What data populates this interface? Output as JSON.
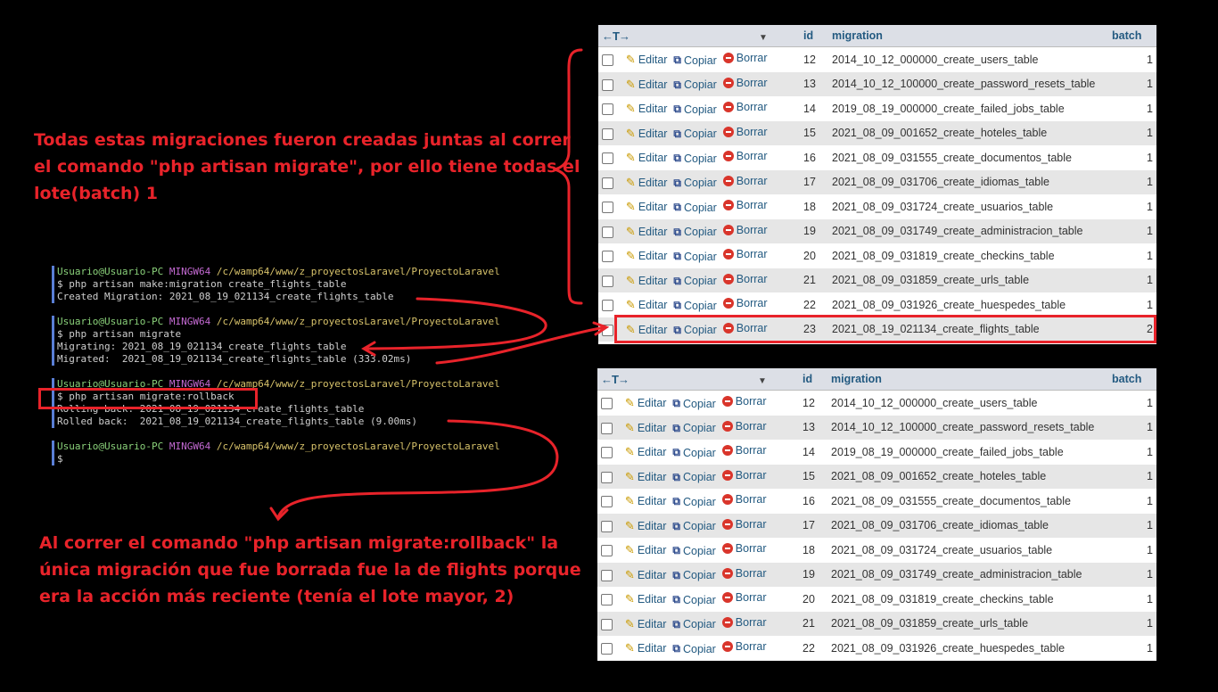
{
  "annotations": {
    "top_note": [
      "Todas estas migraciones fueron creadas juntas al correr",
      "el comando \"php artisan migrate\", por ello tiene todas el",
      "lote(batch) 1"
    ],
    "bottom_note": [
      "Al correr el comando \"php artisan migrate:rollback\" la",
      "única migración que fue borrada fue la de flights porque",
      "era la acción más reciente (tenía el lote mayor, 2)"
    ]
  },
  "terminal": {
    "prompt_user": "Usuario@Usuario-PC",
    "prompt_shell": "MINGW64",
    "prompt_path": "/c/wamp64/www/z_proyectosLaravel/ProyectoLaravel",
    "lines": [
      {
        "cmd": "$ php artisan make:migration create_flights_table"
      },
      {
        "out": "Created Migration: 2021_08_19_021134_create_flights_table"
      },
      {
        "cmd": "$ php artisan migrate"
      },
      {
        "out": "Migrating: 2021_08_19_021134_create_flights_table"
      },
      {
        "out": "Migrated:  2021_08_19_021134_create_flights_table (333.02ms)"
      },
      {
        "cmd": "$ php artisan migrate:rollback"
      },
      {
        "out": "Rolling back: 2021_08_19_021134_create_flights_table"
      },
      {
        "out": "Rolled back:  2021_08_19_021134_create_flights_table (9.00ms)"
      },
      {
        "cmd": "$"
      }
    ]
  },
  "table_header": {
    "arrows": "←T→",
    "col_id": "id",
    "col_migration": "migration",
    "col_batch": "batch"
  },
  "actions": {
    "edit": "Editar",
    "copy": "Copiar",
    "delete": "Borrar"
  },
  "top_table": [
    {
      "id": "12",
      "migration": "2014_10_12_000000_create_users_table",
      "batch": "1"
    },
    {
      "id": "13",
      "migration": "2014_10_12_100000_create_password_resets_table",
      "batch": "1"
    },
    {
      "id": "14",
      "migration": "2019_08_19_000000_create_failed_jobs_table",
      "batch": "1"
    },
    {
      "id": "15",
      "migration": "2021_08_09_001652_create_hoteles_table",
      "batch": "1"
    },
    {
      "id": "16",
      "migration": "2021_08_09_031555_create_documentos_table",
      "batch": "1"
    },
    {
      "id": "17",
      "migration": "2021_08_09_031706_create_idiomas_table",
      "batch": "1"
    },
    {
      "id": "18",
      "migration": "2021_08_09_031724_create_usuarios_table",
      "batch": "1"
    },
    {
      "id": "19",
      "migration": "2021_08_09_031749_create_administracion_table",
      "batch": "1"
    },
    {
      "id": "20",
      "migration": "2021_08_09_031819_create_checkins_table",
      "batch": "1"
    },
    {
      "id": "21",
      "migration": "2021_08_09_031859_create_urls_table",
      "batch": "1"
    },
    {
      "id": "22",
      "migration": "2021_08_09_031926_create_huespedes_table",
      "batch": "1"
    },
    {
      "id": "23",
      "migration": "2021_08_19_021134_create_flights_table",
      "batch": "2"
    }
  ],
  "bottom_table": [
    {
      "id": "12",
      "migration": "2014_10_12_000000_create_users_table",
      "batch": "1"
    },
    {
      "id": "13",
      "migration": "2014_10_12_100000_create_password_resets_table",
      "batch": "1"
    },
    {
      "id": "14",
      "migration": "2019_08_19_000000_create_failed_jobs_table",
      "batch": "1"
    },
    {
      "id": "15",
      "migration": "2021_08_09_001652_create_hoteles_table",
      "batch": "1"
    },
    {
      "id": "16",
      "migration": "2021_08_09_031555_create_documentos_table",
      "batch": "1"
    },
    {
      "id": "17",
      "migration": "2021_08_09_031706_create_idiomas_table",
      "batch": "1"
    },
    {
      "id": "18",
      "migration": "2021_08_09_031724_create_usuarios_table",
      "batch": "1"
    },
    {
      "id": "19",
      "migration": "2021_08_09_031749_create_administracion_table",
      "batch": "1"
    },
    {
      "id": "20",
      "migration": "2021_08_09_031819_create_checkins_table",
      "batch": "1"
    },
    {
      "id": "21",
      "migration": "2021_08_09_031859_create_urls_table",
      "batch": "1"
    },
    {
      "id": "22",
      "migration": "2021_08_09_031926_create_huespedes_table",
      "batch": "1"
    }
  ],
  "colors": {
    "annotation_red": "#e8232a",
    "header_bg": "#dcdfe6",
    "link_blue": "#235a81"
  }
}
